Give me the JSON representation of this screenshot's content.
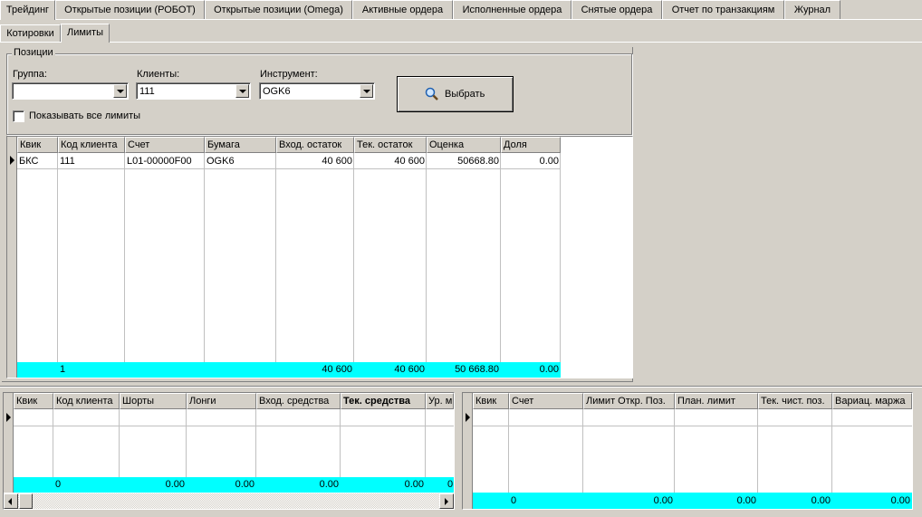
{
  "top_tabs": [
    "Трейдинг",
    "Открытые позиции (РОБОТ)",
    "Открытые позиции (Omega)",
    "Активные ордера",
    "Исполненные ордера",
    "Снятые ордера",
    "Отчет по транзакциям",
    "Журнал"
  ],
  "sub_tabs": [
    "Котировки",
    "Лимиты"
  ],
  "positions": {
    "group_title": "Позиции",
    "group_label": "Группа:",
    "group_value": "",
    "clients_label": "Клиенты:",
    "clients_value": "111",
    "instrument_label": "Инструмент:",
    "instrument_value": "OGK6",
    "select_button": "Выбрать",
    "show_all_limits": "Показывать все лимиты"
  },
  "main_grid": {
    "headers": [
      "Квик",
      "Код клиента",
      "Счет",
      "Бумага",
      "Вход. остаток",
      "Тек. остаток",
      "Оценка",
      "Доля"
    ],
    "rows": [
      [
        "БКС",
        "111",
        "L01-00000F00",
        "OGK6",
        "40 600",
        "40 600",
        "50668.80",
        "0.00"
      ]
    ],
    "totals": [
      "",
      "1",
      "",
      "",
      "40 600",
      "40 600",
      "50 668.80",
      "0.00"
    ]
  },
  "left_grid": {
    "headers": [
      "Квик",
      "Код клиента",
      "Шорты",
      "Лонги",
      "Вход. средства",
      "Тек. средства",
      "Ур. м"
    ],
    "totals": [
      "",
      "0",
      "0.00",
      "0.00",
      "0.00",
      "0.00",
      "0."
    ]
  },
  "right_grid": {
    "headers": [
      "Квик",
      "Счет",
      "Лимит Откр. Поз.",
      "План. лимит",
      "Тек. чист. поз.",
      "Вариац. маржа"
    ],
    "totals": [
      "",
      "0",
      "0.00",
      "0.00",
      "0.00",
      "0.00"
    ]
  },
  "colors": {
    "total_row": "#00ffff",
    "window": "#d4d0c8"
  }
}
